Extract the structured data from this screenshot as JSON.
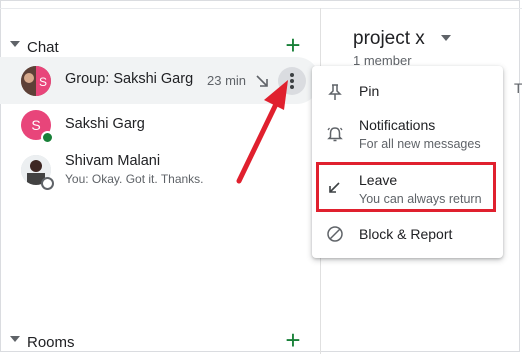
{
  "sidebar": {
    "chat_section": {
      "title": "Chat"
    },
    "rooms_section": {
      "title": "Rooms"
    },
    "chats": [
      {
        "name": "Group: Sakshi Garg",
        "time": "23 min"
      },
      {
        "name": "Sakshi Garg",
        "avatar_letter": "S"
      },
      {
        "name": "Shivam Malani",
        "preview": "You: Okay. Got it. Thanks."
      }
    ]
  },
  "main": {
    "title": "project x",
    "subtitle": "1 member",
    "tab_letter": "T"
  },
  "context_menu": {
    "items": [
      {
        "label": "Pin",
        "icon": "pin-icon"
      },
      {
        "label": "Notifications",
        "sublabel": "For all new messages",
        "icon": "bell-icon"
      },
      {
        "label": "Leave",
        "sublabel": "You can always return",
        "icon": "leave-arrow-icon"
      },
      {
        "label": "Block & Report",
        "icon": "block-icon"
      }
    ]
  },
  "colors": {
    "accent_green": "#188038",
    "avatar_pink": "#e8457a",
    "annotation_red": "#e0202e"
  }
}
